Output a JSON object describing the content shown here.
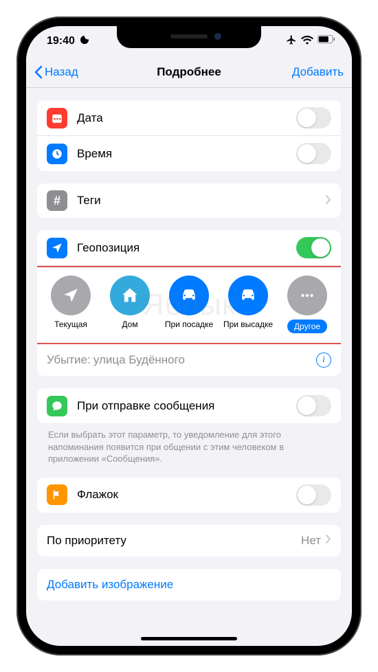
{
  "status": {
    "time": "19:40"
  },
  "nav": {
    "back": "Назад",
    "title": "Подробнее",
    "action": "Добавить"
  },
  "rows": {
    "date": {
      "label": "Дата",
      "on": false
    },
    "time": {
      "label": "Время",
      "on": false
    },
    "tags": {
      "label": "Теги"
    },
    "location": {
      "label": "Геопозиция",
      "on": true
    },
    "messaging": {
      "label": "При отправке сообщения",
      "on": false
    },
    "flag": {
      "label": "Флажок",
      "on": false
    },
    "priority": {
      "label": "По приоритету",
      "value": "Нет"
    },
    "addImage": {
      "label": "Добавить изображение"
    }
  },
  "locationOptions": {
    "current": "Текущая",
    "home": "Дом",
    "gettingIn": "При посадке",
    "gettingOut": "При высадке",
    "other": "Другое"
  },
  "departure": {
    "label": "Убытие:",
    "value": "улица Будённого"
  },
  "footnote": "Если выбрать этот параметр, то уведомление для этого напоминания появится при общении с этим человеком в приложении «Сообщения».",
  "watermark": "Яблык",
  "colors": {
    "blue": "#007aff",
    "green": "#34c759",
    "red": "#ff3b30",
    "gray": "#a8a8ad",
    "orange": "#ff9500"
  }
}
